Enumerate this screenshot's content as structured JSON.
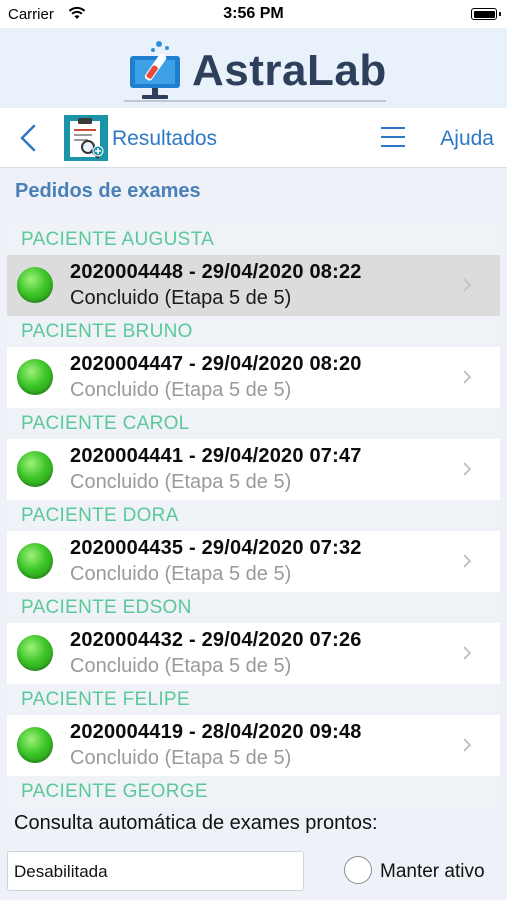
{
  "status_bar": {
    "carrier": "Carrier",
    "time": "3:56 PM"
  },
  "app": {
    "logo_text": "AstraLab"
  },
  "nav": {
    "title": "Resultados",
    "help": "Ajuda"
  },
  "section_title": "Pedidos de exames",
  "patients": [
    {
      "name": "PACIENTE AUGUSTA",
      "title": "2020004448 - 29/04/2020 08:22",
      "status": "Concluido (Etapa 5 de 5)",
      "selected": true
    },
    {
      "name": "PACIENTE BRUNO",
      "title": "2020004447 - 29/04/2020 08:20",
      "status": "Concluido (Etapa 5 de 5)"
    },
    {
      "name": "PACIENTE CAROL",
      "title": "2020004441 - 29/04/2020 07:47",
      "status": "Concluido (Etapa 5 de 5)"
    },
    {
      "name": "PACIENTE DORA",
      "title": "2020004435 - 29/04/2020 07:32",
      "status": "Concluido (Etapa 5 de 5)"
    },
    {
      "name": "PACIENTE EDSON",
      "title": "2020004432 - 29/04/2020 07:26",
      "status": "Concluido (Etapa 5 de 5)"
    },
    {
      "name": "PACIENTE FELIPE",
      "title": "2020004419 - 28/04/2020 09:48",
      "status": "Concluido (Etapa 5 de 5)"
    },
    {
      "name": "PACIENTE GEORGE"
    }
  ],
  "auto_check": {
    "label": "Consulta automática de exames prontos:",
    "select_value": "Desabilitada",
    "keep_active_label": "Manter ativo"
  },
  "colors": {
    "accent": "#2d78c4",
    "patient_header": "#5cc89a",
    "status_ok": "#3ec62a"
  }
}
